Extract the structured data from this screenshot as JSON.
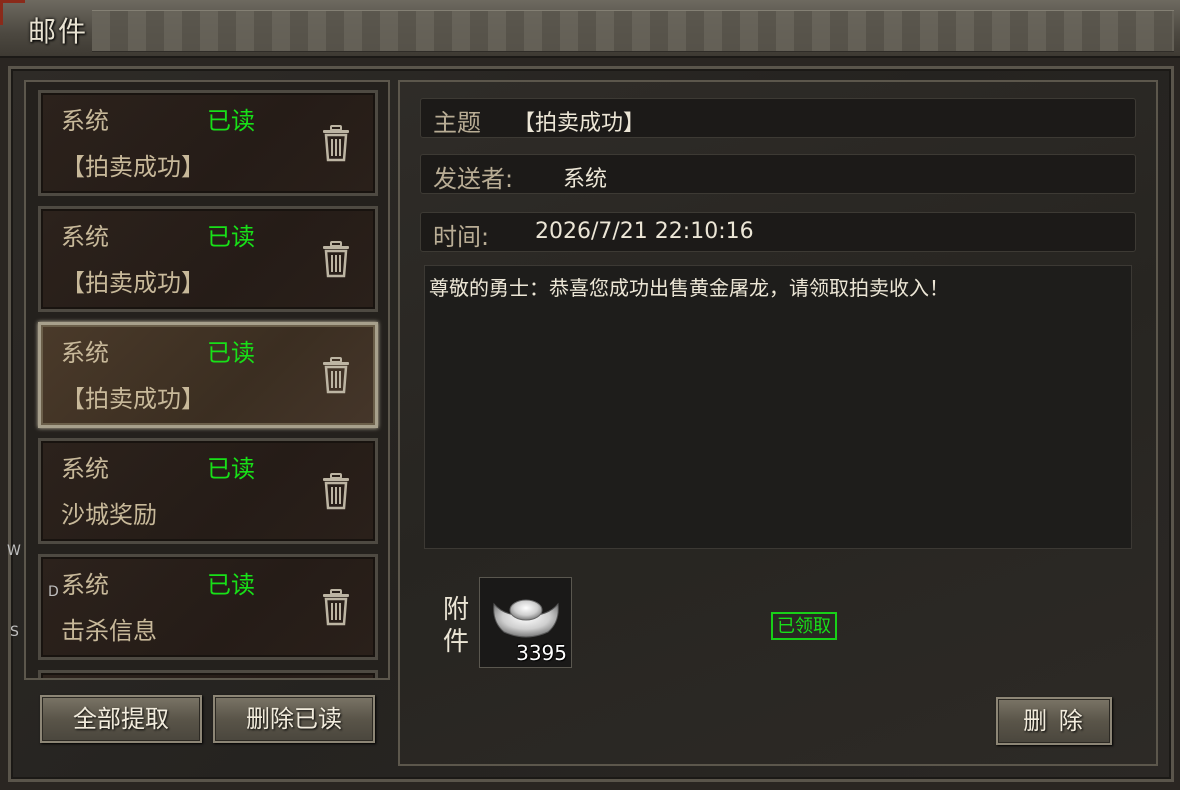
{
  "window": {
    "title": "邮件"
  },
  "mail_list": [
    {
      "sender": "系统",
      "status": "已读",
      "subject": "【拍卖成功】",
      "selected": false
    },
    {
      "sender": "系统",
      "status": "已读",
      "subject": "【拍卖成功】",
      "selected": false
    },
    {
      "sender": "系统",
      "status": "已读",
      "subject": "【拍卖成功】",
      "selected": true
    },
    {
      "sender": "系统",
      "status": "已读",
      "subject": "沙城奖励",
      "selected": false
    },
    {
      "sender": "系统",
      "status": "已读",
      "subject": "击杀信息",
      "selected": false
    }
  ],
  "list_buttons": {
    "claim_all": "全部提取",
    "delete_read": "删除已读"
  },
  "detail": {
    "subject_label": "主题",
    "subject_value": "【拍卖成功】",
    "sender_label": "发送者:",
    "sender_value": "系统",
    "time_label": "时间:",
    "time_value": "2026/7/21 22:10:16",
    "body": "尊敬的勇士：恭喜您成功出售黄金屠龙，请领取拍卖收入！",
    "attachment_label": "附件",
    "attachment": {
      "icon": "silver-ingot-icon",
      "quantity": "3395"
    },
    "claimed_badge": "已领取",
    "delete_button": "删 除"
  },
  "side_hints": [
    "W",
    "D",
    "S"
  ],
  "colors": {
    "read_status": "#18e018",
    "text_main": "#ece6d6",
    "text_label": "#b9ad95"
  }
}
